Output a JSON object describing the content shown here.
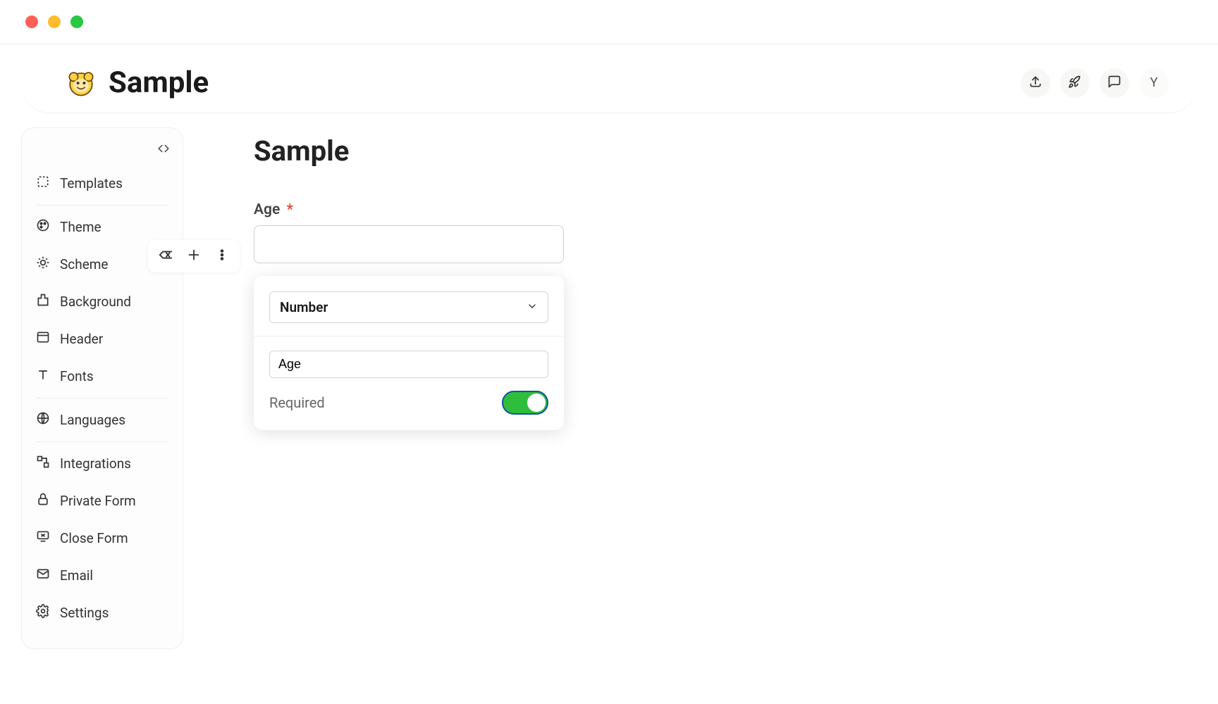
{
  "header": {
    "title": "Sample",
    "avatar_initial": "Y"
  },
  "sidebar": {
    "items": [
      {
        "label": "Templates"
      },
      {
        "label": "Theme"
      },
      {
        "label": "Scheme"
      },
      {
        "label": "Background"
      },
      {
        "label": "Header"
      },
      {
        "label": "Fonts"
      },
      {
        "label": "Languages"
      },
      {
        "label": "Integrations"
      },
      {
        "label": "Private Form"
      },
      {
        "label": "Close Form"
      },
      {
        "label": "Email"
      },
      {
        "label": "Settings"
      }
    ]
  },
  "form": {
    "title": "Sample",
    "field": {
      "label": "Age",
      "required_marker": "*",
      "value": ""
    },
    "settings": {
      "type": "Number",
      "name_value": "Age",
      "required_label": "Required",
      "required_on": true
    }
  }
}
